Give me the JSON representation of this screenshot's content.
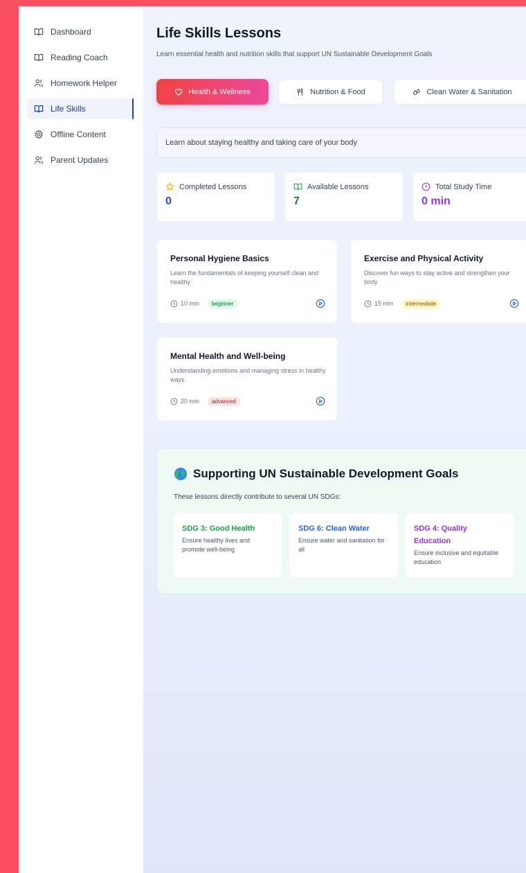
{
  "sidebar": {
    "items": [
      {
        "label": "Dashboard",
        "icon": "book-open-icon"
      },
      {
        "label": "Reading Coach",
        "icon": "book-open-icon"
      },
      {
        "label": "Homework Helper",
        "icon": "users-icon"
      },
      {
        "label": "Life Skills",
        "icon": "book-open-icon",
        "active": true
      },
      {
        "label": "Offline Content",
        "icon": "gear-icon"
      },
      {
        "label": "Parent Updates",
        "icon": "users-icon"
      }
    ]
  },
  "header": {
    "title": "Life Skills Lessons",
    "subtitle": "Learn essential health and nutrition skills that support UN Sustainable Development Goals"
  },
  "tabs": [
    {
      "label": "Health & Wellness",
      "icon": "heart-icon",
      "active": true
    },
    {
      "label": "Nutrition & Food",
      "icon": "utensils-icon"
    },
    {
      "label": "Clean Water & Sanitation",
      "icon": "droplets-icon"
    }
  ],
  "description": "Learn about staying healthy and taking care of your body",
  "stats": [
    {
      "label": "Completed Lessons",
      "value": "0",
      "icon": "star-icon",
      "color": "#1d4ed8"
    },
    {
      "label": "Available Lessons",
      "value": "7",
      "icon": "book-open-icon",
      "color": "#15803d"
    },
    {
      "label": "Total Study Time",
      "value": "0 min",
      "icon": "clock-icon",
      "color": "#9333ea"
    }
  ],
  "lessons": [
    {
      "title": "Personal Hygiene Basics",
      "description": "Learn the fundamentals of keeping yourself clean and healthy",
      "duration": "10 min",
      "level": "beginner"
    },
    {
      "title": "Exercise and Physical Activity",
      "description": "Discover fun ways to stay active and strengthen your body",
      "duration": "15 min",
      "level": "intermediate"
    },
    {
      "title": "Mental Health and Well-being",
      "description": "Understanding emotions and managing stress in healthy ways",
      "duration": "20 min",
      "level": "advanced"
    }
  ],
  "sdg": {
    "title": "Supporting UN Sustainable Development Goals",
    "intro": "These lessons directly contribute to several UN SDGs:",
    "cards": [
      {
        "title": "SDG 3: Good Health",
        "description": "Ensure healthy lives and promote well-being",
        "color": "#16a34a"
      },
      {
        "title": "SDG 6: Clean Water",
        "description": "Ensure water and sanitation for all",
        "color": "#2563eb"
      },
      {
        "title": "SDG 4: Quality Education",
        "description": "Ensure inclusive and equitable education",
        "color": "#9333ea"
      }
    ]
  },
  "colors": {
    "accent_gradient": [
      "#ef4444",
      "#ec4899"
    ],
    "frame": "#fb5062",
    "badge_beginner": "#dcfce7",
    "badge_intermediate": "#fef9c3",
    "badge_advanced": "#fee2e2"
  }
}
